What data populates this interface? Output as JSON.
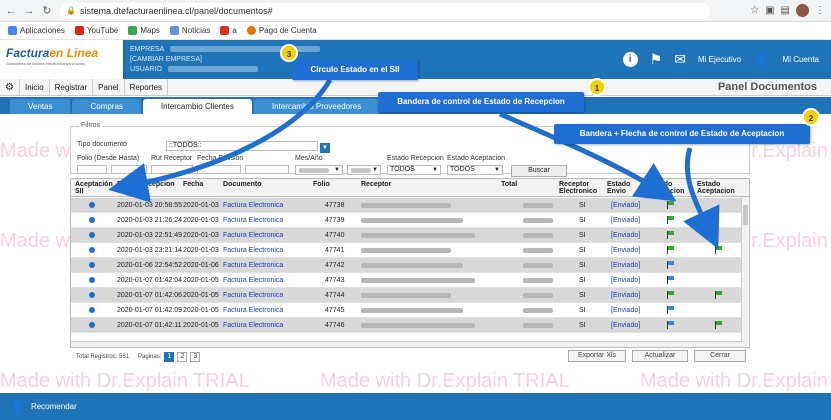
{
  "browser": {
    "url": "sistema.dtefacturaenlinea.cl/panel/documentos#",
    "bookmarks": [
      "Aplicaciones",
      "YouTube",
      "Maps",
      "Noticias",
      "a",
      "Pago de Cuenta"
    ]
  },
  "header": {
    "logo_main": "Factura",
    "logo_accent": "en Linea",
    "logo_sub": "Soluciones de factura electrónica para todos",
    "empresa_label": "EMPRESA",
    "cambiar_empresa": "[CAMBIAR EMPRESA]",
    "usuario_label": "USUARIO",
    "mi_ejecutivo": "Mi Ejecutivo",
    "mi_cuenta": "Mi Cuenta"
  },
  "menu": {
    "items": [
      "Inicio",
      "Registrar",
      "Panel",
      "Reportes"
    ],
    "panel_title": "Panel Documentos"
  },
  "tabs": [
    "Ventas",
    "Compras",
    "Intercambio Clientes",
    "Intercambio Proveedores"
  ],
  "filtros": {
    "legend": "Filtros",
    "tipo_documento_label": "Tipo documento",
    "tipo_documento_value": "::TODOS::",
    "folio_label": "Folio (Desde Hasta)",
    "rut_label": "Rut Receptor",
    "fecha_label": "Fecha Emision",
    "mes_label": "Mes/Año",
    "estado_recepcion_label": "Estado Recepcion",
    "estado_recepcion_value": "TODOS",
    "estado_aceptacion_label": "Estado Aceptacion",
    "estado_aceptacion_value": "TODOS",
    "buscar": "Buscar"
  },
  "table": {
    "headers": {
      "aceptacion": "Aceptación SII",
      "fecha_recepcion": "Fecha Recepcion SII",
      "fecha": "Fecha",
      "documento": "Documento",
      "folio": "Folio",
      "receptor": "Receptor",
      "total": "Total",
      "receptor_electronico": "Receptor Electronico",
      "estado_envio": "Estado Envio",
      "estado_recepcion": "Estado Recepcion",
      "estado_aceptacion": "Estado Aceptacion"
    },
    "rows": [
      {
        "fecha_recepcion": "2020-01-03 20:58:55",
        "fecha": "2020-01-03",
        "documento": "Factura Electronica",
        "folio": "47738",
        "receptor_electronico": "SI",
        "estado_envio": "[Enviado]",
        "recepcion_flag": "green",
        "aceptacion_flag": ""
      },
      {
        "fecha_recepcion": "2020-01-03 21:26:24",
        "fecha": "2020-01-03",
        "documento": "Factura Electronica",
        "folio": "47739",
        "receptor_electronico": "SI",
        "estado_envio": "[Enviado]",
        "recepcion_flag": "green",
        "aceptacion_flag": ""
      },
      {
        "fecha_recepcion": "2020-01-03 22:51:49",
        "fecha": "2020-01-03",
        "documento": "Factura Electronica",
        "folio": "47740",
        "receptor_electronico": "SI",
        "estado_envio": "[Enviado]",
        "recepcion_flag": "green",
        "aceptacion_flag": ""
      },
      {
        "fecha_recepcion": "2020-01-03 23:21:14",
        "fecha": "2020-01-03",
        "documento": "Factura Electronica",
        "folio": "47741",
        "receptor_electronico": "SI",
        "estado_envio": "[Enviado]",
        "recepcion_flag": "green",
        "aceptacion_flag": "green"
      },
      {
        "fecha_recepcion": "2020-01-06 22:54:52",
        "fecha": "2020-01-06",
        "documento": "Factura Electronica",
        "folio": "47742",
        "receptor_electronico": "SI",
        "estado_envio": "[Enviado]",
        "recepcion_flag": "blue",
        "aceptacion_flag": ""
      },
      {
        "fecha_recepcion": "2020-01-07 01:42:04",
        "fecha": "2020-01-05",
        "documento": "Factura Electronica",
        "folio": "47743",
        "receptor_electronico": "SI",
        "estado_envio": "[Enviado]",
        "recepcion_flag": "blue",
        "aceptacion_flag": ""
      },
      {
        "fecha_recepcion": "2020-01-07 01:42:06",
        "fecha": "2020-01-05",
        "documento": "Factura Electronica",
        "folio": "47744",
        "receptor_electronico": "SI",
        "estado_envio": "[Enviado]",
        "recepcion_flag": "green",
        "aceptacion_flag": "green"
      },
      {
        "fecha_recepcion": "2020-01-07 01:42:09",
        "fecha": "2020-01-05",
        "documento": "Factura Electronica",
        "folio": "47745",
        "receptor_electronico": "SI",
        "estado_envio": "[Enviado]",
        "recepcion_flag": "blue",
        "aceptacion_flag": ""
      },
      {
        "fecha_recepcion": "2020-01-07 01:42:11",
        "fecha": "2020-01-05",
        "documento": "Factura Electronica",
        "folio": "47746",
        "receptor_electronico": "SI",
        "estado_envio": "[Enviado]",
        "recepcion_flag": "blue",
        "aceptacion_flag": "green"
      }
    ]
  },
  "footer": {
    "total_registros": "Total Registros: 561",
    "paginas_label": "Paginas:",
    "pages": [
      "1",
      "2",
      "3"
    ],
    "exportar": "Exportar Xls",
    "actualizar": "Actualizar",
    "cerrar": "Cerrar"
  },
  "bottom_bar": {
    "recomendar": "Recomendar"
  },
  "callouts": {
    "c1": {
      "number": "1",
      "text": "Bandera de control de Estado de Recepcion"
    },
    "c2": {
      "number": "2",
      "text": "Bandera + Flecha de control de Estado de Aceptacion"
    },
    "c3": {
      "number": "3",
      "text": "Circulo Estado en el SII"
    }
  },
  "watermark": {
    "prefix": "Made with Dr.Explain",
    "suffix": "TRIAL"
  },
  "colors": {
    "primary": "#1f74b8",
    "callout": "#1f6fd3",
    "badge": "#f4d100",
    "flag_green": "#3aa33a",
    "flag_blue": "#3b88d8"
  }
}
